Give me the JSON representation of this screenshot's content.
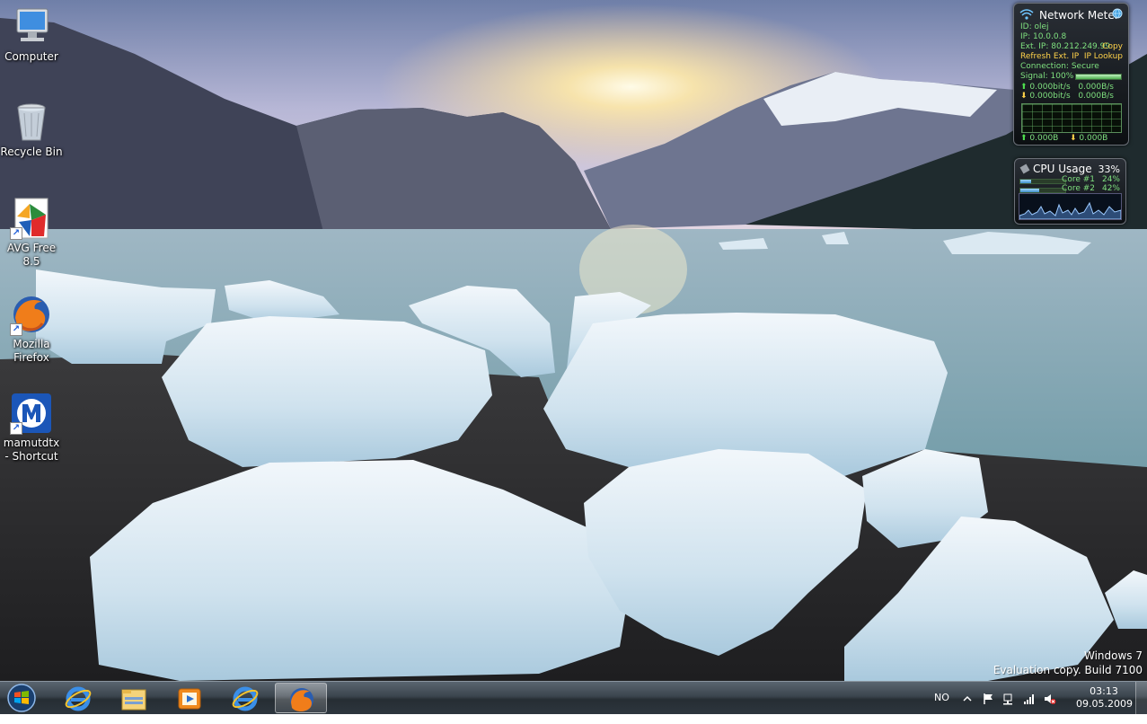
{
  "desktop": {
    "icons": [
      {
        "label": "Computer"
      },
      {
        "label": "Recycle Bin"
      },
      {
        "label": "AVG Free 8.5"
      },
      {
        "label": "Mozilla Firefox"
      },
      {
        "label": "mamutdtx - Shortcut"
      }
    ]
  },
  "network_meter": {
    "title": "Network Meter",
    "id_line": "ID: olej",
    "ip_line": "IP: 10.0.0.8",
    "ext_ip_line": "Ext. IP: 80.212.249.99",
    "copy_link": "Copy",
    "refresh_link": "Refresh Ext. IP",
    "lookup_link": "IP Lookup",
    "connection_line": "Connection: Secure",
    "signal_line": "Signal: 100%",
    "signal_level": 1.0,
    "up_rate": "0.000bit/s",
    "up_bytes": "0.000B/s",
    "down_rate": "0.000bit/s",
    "down_bytes": "0.000B/s",
    "up_total": "0.000B",
    "down_total": "0.000B"
  },
  "cpu_usage": {
    "title": "CPU Usage",
    "total": "33%",
    "cores": [
      {
        "label": "Core #1",
        "value": "24%",
        "level": 0.24
      },
      {
        "label": "Core #2",
        "value": "42%",
        "level": 0.42
      }
    ]
  },
  "watermark": {
    "line1": "Windows 7",
    "line2": "Evaluation copy. Build 7100"
  },
  "taskbar": {
    "pinned": [
      "start-orb",
      "internet-explorer",
      "windows-explorer",
      "media-player",
      "internet-explorer",
      "firefox"
    ],
    "language": "NO",
    "time": "03:13",
    "date": "09.05.2009"
  },
  "colors": {
    "gadget_text": "#7fe07f",
    "gadget_link": "#ffd24a",
    "taskbar": "#3b444d"
  }
}
